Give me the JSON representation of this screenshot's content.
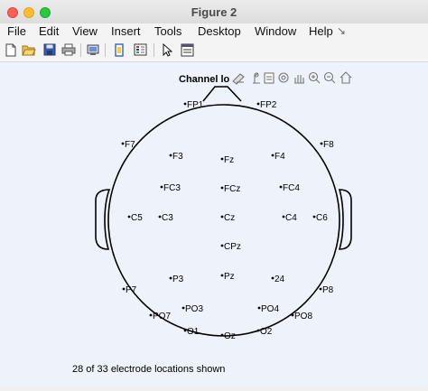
{
  "window": {
    "title": "Figure 2"
  },
  "menu": [
    "File",
    "Edit",
    "View",
    "Insert",
    "Tools",
    "Desktop",
    "Window",
    "Help"
  ],
  "toolbar": {
    "icons": [
      "new-figure-icon",
      "open-file-icon",
      "save-icon",
      "print-icon",
      "print-preview-icon",
      "link-icon",
      "insert-legend-icon",
      "pointer-icon",
      "property-editor-icon"
    ]
  },
  "axes_toolbar": {
    "icons": [
      "brush-icon",
      "data-tips-icon",
      "save-view-icon",
      "rotate-icon",
      "pan-icon",
      "zoom-in-icon",
      "zoom-out-icon",
      "home-icon"
    ]
  },
  "plot": {
    "title": "Channel lo",
    "status": "28 of 33 electrode locations shown",
    "electrodes": [
      {
        "label": "FP1"
      },
      {
        "label": "FP2"
      },
      {
        "label": "F7"
      },
      {
        "label": "F8"
      },
      {
        "label": "F3"
      },
      {
        "label": "Fz"
      },
      {
        "label": "F4"
      },
      {
        "label": "FC3"
      },
      {
        "label": "FCz"
      },
      {
        "label": "FC4"
      },
      {
        "label": "C5"
      },
      {
        "label": "C3"
      },
      {
        "label": "Cz"
      },
      {
        "label": "C4"
      },
      {
        "label": "C6"
      },
      {
        "label": "CPz"
      },
      {
        "label": "P3"
      },
      {
        "label": "Pz"
      },
      {
        "label": "24"
      },
      {
        "label": "P7"
      },
      {
        "label": "P8"
      },
      {
        "label": "PO3"
      },
      {
        "label": "PO4"
      },
      {
        "label": "PO7"
      },
      {
        "label": "PO8"
      },
      {
        "label": "O1"
      },
      {
        "label": "Oz"
      },
      {
        "label": "O2"
      }
    ]
  }
}
